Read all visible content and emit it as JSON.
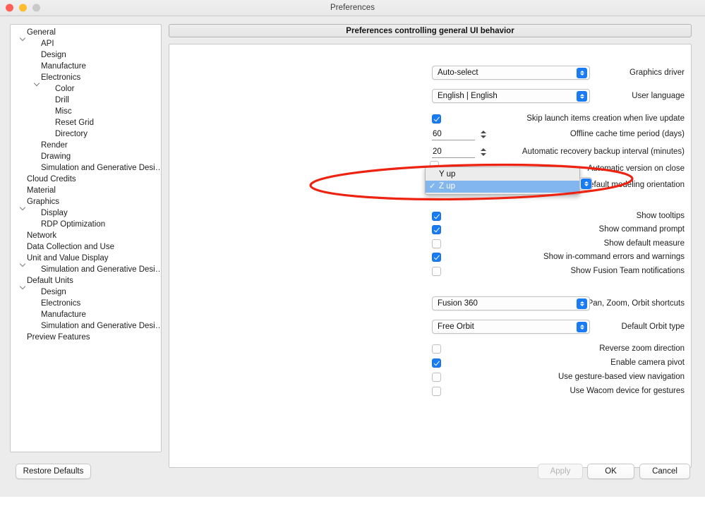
{
  "window": {
    "title": "Preferences",
    "traffic_lights": [
      "close",
      "minimize",
      "zoom"
    ]
  },
  "sidebar": {
    "items": [
      {
        "label": "General",
        "indent": 0,
        "twisty": "open"
      },
      {
        "label": "API",
        "indent": 1,
        "twisty": "none"
      },
      {
        "label": "Design",
        "indent": 1,
        "twisty": "none"
      },
      {
        "label": "Manufacture",
        "indent": 1,
        "twisty": "none"
      },
      {
        "label": "Electronics",
        "indent": 1,
        "twisty": "open"
      },
      {
        "label": "Color",
        "indent": 2,
        "twisty": "none"
      },
      {
        "label": "Drill",
        "indent": 2,
        "twisty": "none"
      },
      {
        "label": "Misc",
        "indent": 2,
        "twisty": "none"
      },
      {
        "label": "Reset Grid",
        "indent": 2,
        "twisty": "none"
      },
      {
        "label": "Directory",
        "indent": 2,
        "twisty": "none"
      },
      {
        "label": "Render",
        "indent": 1,
        "twisty": "none"
      },
      {
        "label": "Drawing",
        "indent": 1,
        "twisty": "none"
      },
      {
        "label": "Simulation and Generative Desi…",
        "indent": 1,
        "twisty": "none"
      },
      {
        "label": "Cloud Credits",
        "indent": 0,
        "twisty": "none"
      },
      {
        "label": "Material",
        "indent": 0,
        "twisty": "none"
      },
      {
        "label": "Graphics",
        "indent": 0,
        "twisty": "open"
      },
      {
        "label": "Display",
        "indent": 1,
        "twisty": "none"
      },
      {
        "label": "RDP Optimization",
        "indent": 1,
        "twisty": "none"
      },
      {
        "label": "Network",
        "indent": 0,
        "twisty": "none"
      },
      {
        "label": "Data Collection and Use",
        "indent": 0,
        "twisty": "none"
      },
      {
        "label": "Unit and Value Display",
        "indent": 0,
        "twisty": "open"
      },
      {
        "label": "Simulation and Generative Desi…",
        "indent": 1,
        "twisty": "none"
      },
      {
        "label": "Default Units",
        "indent": 0,
        "twisty": "open"
      },
      {
        "label": "Design",
        "indent": 1,
        "twisty": "none"
      },
      {
        "label": "Electronics",
        "indent": 1,
        "twisty": "none"
      },
      {
        "label": "Manufacture",
        "indent": 1,
        "twisty": "none"
      },
      {
        "label": "Simulation and Generative Desi…",
        "indent": 1,
        "twisty": "none"
      },
      {
        "label": "Preview Features",
        "indent": 0,
        "twisty": "none"
      }
    ]
  },
  "content": {
    "header": "Preferences controlling general UI behavior",
    "fields": {
      "graphics_driver": {
        "label": "Graphics driver",
        "value": "Auto-select"
      },
      "user_language": {
        "label": "User language",
        "value": "English | English"
      },
      "skip_launch_items": {
        "label": "Skip launch items creation when live update",
        "checked": true
      },
      "offline_cache": {
        "label": "Offline cache time period (days)",
        "value": "60"
      },
      "auto_recovery": {
        "label": "Automatic recovery backup interval (minutes)",
        "value": "20"
      },
      "auto_version_on_close": {
        "label": "Automatic version on close",
        "checked": false
      },
      "default_modeling_orientation": {
        "label": "Default modeling orientation",
        "value": "Z up"
      },
      "show_tooltips": {
        "label": "Show tooltips",
        "checked": true
      },
      "show_command_prompt": {
        "label": "Show command prompt",
        "checked": true
      },
      "show_default_measure": {
        "label": "Show default measure",
        "checked": false
      },
      "show_in_command_errors": {
        "label": "Show in-command errors and warnings",
        "checked": true
      },
      "show_fusion_team_notifications": {
        "label": "Show Fusion Team notifications",
        "checked": false
      },
      "pan_zoom_orbit": {
        "label": "Pan, Zoom, Orbit shortcuts",
        "value": "Fusion 360"
      },
      "default_orbit_type": {
        "label": "Default Orbit type",
        "value": "Free Orbit"
      },
      "reverse_zoom": {
        "label": "Reverse zoom direction",
        "checked": false
      },
      "enable_camera_pivot": {
        "label": "Enable camera pivot",
        "checked": true
      },
      "gesture_navigation": {
        "label": "Use gesture-based view navigation",
        "checked": false
      },
      "wacom_gestures": {
        "label": "Use Wacom device for gestures",
        "checked": false
      }
    }
  },
  "dropdown_popup": {
    "open": true,
    "options": [
      {
        "label": "Y up",
        "selected": false,
        "check": ""
      },
      {
        "label": "Z up",
        "selected": true,
        "check": "✓"
      }
    ]
  },
  "annotation": {
    "shape": "ellipse",
    "color": "#ee2211",
    "target": "Default modeling orientation"
  },
  "footer": {
    "restore_defaults": "Restore Defaults",
    "apply": "Apply",
    "ok": "OK",
    "cancel": "Cancel"
  }
}
